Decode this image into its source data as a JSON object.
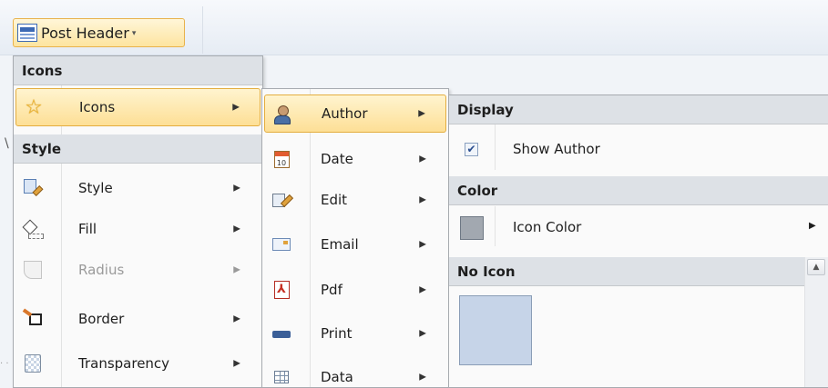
{
  "toolbar": {
    "button_label": "Post Header",
    "button_icon": "document-header-icon",
    "caret_icon": "dropdown-caret-icon"
  },
  "document": {
    "left_mark": "\\",
    "dots": "· ·"
  },
  "menu1": {
    "header_icons": "Icons",
    "header_style": "Style",
    "items": [
      {
        "label": "Icons",
        "icon": "star-icon",
        "submenu_arrow": "▶",
        "highlighted": true,
        "enabled": true
      },
      {
        "label": "Style",
        "icon": "style-icon",
        "submenu_arrow": "▶",
        "enabled": true
      },
      {
        "label": "Fill",
        "icon": "paint-bucket-icon",
        "submenu_arrow": "▶",
        "enabled": true
      },
      {
        "label": "Radius",
        "icon": "radius-corner-icon",
        "submenu_arrow": "▶",
        "enabled": false
      },
      {
        "label": "Border",
        "icon": "border-icon",
        "submenu_arrow": "▶",
        "enabled": true
      },
      {
        "label": "Transparency",
        "icon": "transparency-icon",
        "submenu_arrow": "▶",
        "enabled": true
      }
    ]
  },
  "menu2": {
    "items": [
      {
        "label": "Author",
        "icon": "person-icon",
        "submenu_arrow": "▶",
        "highlighted": true
      },
      {
        "label": "Date",
        "icon": "calendar-icon",
        "icon_text": "10",
        "submenu_arrow": "▶"
      },
      {
        "label": "Edit",
        "icon": "edit-pencil-icon",
        "submenu_arrow": "▶"
      },
      {
        "label": "Email",
        "icon": "envelope-icon",
        "submenu_arrow": "▶"
      },
      {
        "label": "Pdf",
        "icon": "pdf-icon",
        "icon_text": "⅄",
        "submenu_arrow": "▶"
      },
      {
        "label": "Print",
        "icon": "printer-icon",
        "submenu_arrow": "▶"
      },
      {
        "label": "Data",
        "icon": "grid-table-icon",
        "submenu_arrow": "▶"
      }
    ]
  },
  "menu3": {
    "header_display": "Display",
    "show_author_label": "Show Author",
    "show_author_checked": true,
    "check_mark": "✔",
    "header_color": "Color",
    "icon_color_label": "Icon Color",
    "icon_color_value": "#a2a8b0",
    "submenu_arrow": "▶",
    "header_no_icon": "No Icon",
    "no_icon_swatch_color": "#c6d4e8",
    "scroll_up_glyph": "▲"
  },
  "colors": {
    "highlight_border": "#e4ad3e",
    "highlight_fill": "#fddf96",
    "menu_header_bg": "#dde1e6"
  }
}
